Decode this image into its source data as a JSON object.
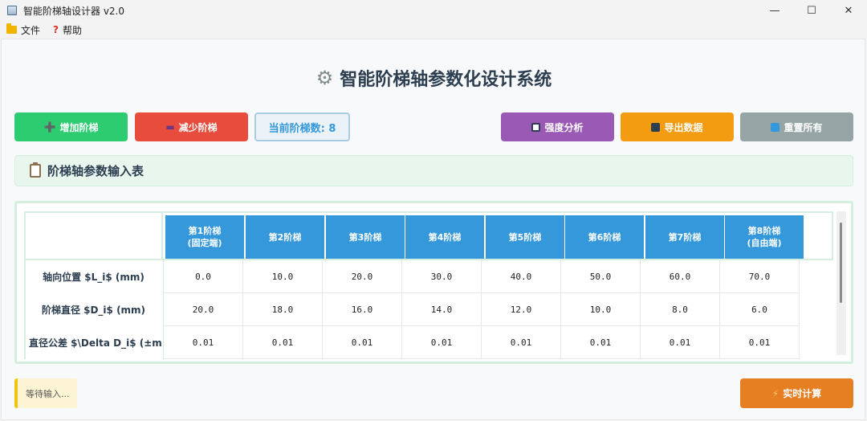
{
  "window": {
    "title": "智能阶梯轴设计器 v2.0",
    "controls": [
      "—",
      "☐",
      "✕"
    ]
  },
  "menu": {
    "file": "文件",
    "help": "帮助"
  },
  "main_title": "智能阶梯轴参数化设计系统",
  "toolbar": {
    "add_label": "增加阶梯",
    "remove_label": "减少阶梯",
    "count_label": "当前阶梯数: 8",
    "strength_label": "强度分析",
    "export_label": "导出数据",
    "reset_label": "重置所有"
  },
  "section_title": "阶梯轴参数输入表",
  "table": {
    "columns": [
      "第1阶梯\n(固定端)",
      "第2阶梯",
      "第3阶梯",
      "第4阶梯",
      "第5阶梯",
      "第6阶梯",
      "第7阶梯",
      "第8阶梯\n(自由端)"
    ],
    "rows": [
      {
        "label": "轴向位置 $L_i$ (mm)",
        "values": [
          "0.0",
          "10.0",
          "20.0",
          "30.0",
          "40.0",
          "50.0",
          "60.0",
          "70.0"
        ]
      },
      {
        "label": "阶梯直径 $D_i$ (mm)",
        "values": [
          "20.0",
          "18.0",
          "16.0",
          "14.0",
          "12.0",
          "10.0",
          "8.0",
          "6.0"
        ]
      },
      {
        "label": "直径公差 $\\Delta D_i$ (±mm)",
        "values": [
          "0.01",
          "0.01",
          "0.01",
          "0.01",
          "0.01",
          "0.01",
          "0.01",
          "0.01"
        ]
      }
    ]
  },
  "status_text": "等待输入...",
  "calc_label": "实时计算",
  "colors": {
    "add": "#2ecc71",
    "remove": "#e74c3c",
    "strength": "#9b59b6",
    "export": "#f39c12",
    "reset": "#95a5a6",
    "calc": "#e67e22",
    "header": "#3498db"
  }
}
